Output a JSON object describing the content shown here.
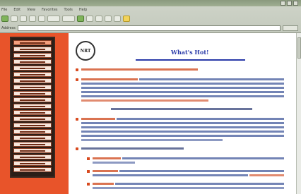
{
  "browser": {
    "menu": [
      "File",
      "Edit",
      "View",
      "Favorites",
      "Tools",
      "Help"
    ],
    "address_label": "Address"
  },
  "page": {
    "title": "What's Hot!",
    "logo_text": "NRT"
  },
  "colors": {
    "sidebar_bg": "#e8542a",
    "nav_panel": "#2b1e17",
    "title_blue": "#2a3aa8",
    "link_orange": "#d45a33"
  },
  "icons": {
    "back": "back-arrow-icon",
    "forward": "forward-arrow-icon",
    "home": "home-icon",
    "search": "search-icon",
    "favorites": "favorites-icon"
  }
}
